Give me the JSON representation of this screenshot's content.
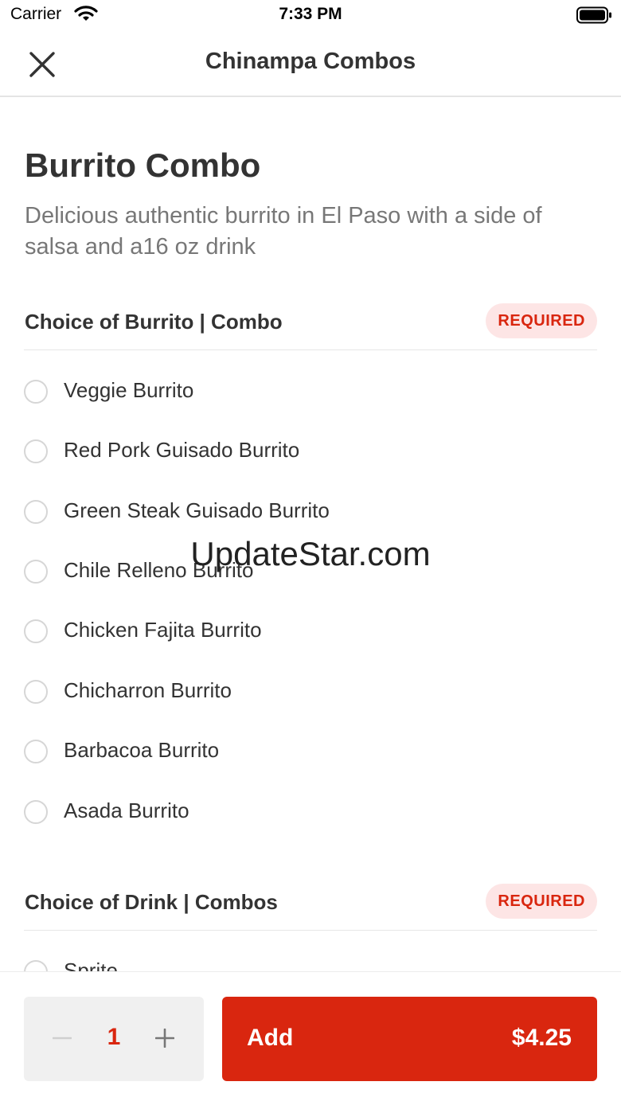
{
  "status_bar": {
    "carrier": "Carrier",
    "time": "7:33 PM"
  },
  "nav": {
    "title": "Chinampa Combos"
  },
  "item": {
    "title": "Burrito Combo",
    "description": "Delicious authentic burrito in El Paso with a side of salsa and a16 oz drink"
  },
  "groups": [
    {
      "title": "Choice of Burrito | Combo",
      "badge": "REQUIRED",
      "options": [
        "Veggie Burrito",
        "Red Pork Guisado Burrito",
        "Green Steak Guisado Burrito",
        "Chile Relleno Burrito",
        "Chicken Fajita Burrito",
        "Chicharron Burrito",
        "Barbacoa Burrito",
        "Asada Burrito"
      ]
    },
    {
      "title": "Choice of Drink | Combos",
      "badge": "REQUIRED",
      "options": [
        "Sprite"
      ]
    }
  ],
  "watermark": "UpdateStar.com",
  "footer": {
    "quantity": "1",
    "add_label": "Add",
    "price": "$4.25"
  },
  "colors": {
    "accent": "#d9260f",
    "badge_bg": "#fde5e5",
    "stepper_bg": "#f0f0f0"
  }
}
